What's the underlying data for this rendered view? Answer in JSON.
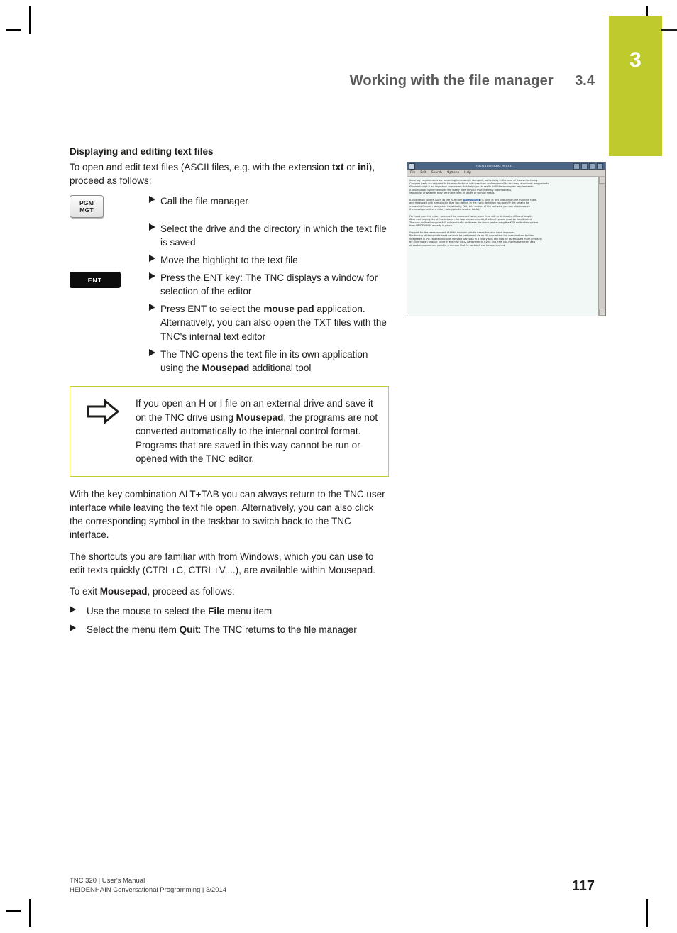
{
  "header": {
    "title": "Working with the file manager",
    "section_number": "3.4",
    "chapter_number": "3"
  },
  "content": {
    "section_title": "Displaying and editing text files",
    "intro_line1_a": "To open and edit text files (ASCII files, e.g. with the extension ",
    "intro_line1_b": "txt",
    "intro_line2_a": "or ",
    "intro_line2_b": "ini",
    "intro_line2_c": "), proceed as follows:",
    "steps": [
      {
        "key": null,
        "text": "Call the file manager"
      },
      {
        "key": "PGM MGT",
        "text": "Select the drive and the directory in which the text file is saved"
      },
      {
        "key": null,
        "text": "Move the highlight to the text file"
      },
      {
        "key": "ENT",
        "text": "Press the ENT key: The TNC displays a window for selection of the editor"
      },
      {
        "key": null,
        "text": "Press ENT to select the mouse pad application. Alternatively, you can also open the TXT files with the TNC's internal text editor"
      },
      {
        "key": null,
        "text": "The TNC opens the text file in its own application using the Mousepad additional tool"
      }
    ],
    "key_pgm_line1": "PGM",
    "key_pgm_line2": "MGT",
    "key_ent": "ENT",
    "note": "If you open an H or I file on an external drive and save it on the TNC drive using Mousepad, the programs are not converted automatically to the internal control format. Programs that are saved in this way cannot be run or opened with the TNC editor.",
    "note_bold": "Mousepad",
    "para_alt_tab": "With the key combination ALT+TAB you can always return to the TNC user interface while leaving the text file open. Alternatively, you can also click the corresponding symbol in the taskbar to switch back to the TNC interface.",
    "para_shortcuts": "The shortcuts you are familiar with from Windows, which you can use to edit texts quickly (CTRL+C, CTRL+V,...), are available within Mousepad.",
    "para_exit_a": "To exit ",
    "para_exit_b": "Mousepad",
    "para_exit_c": ", proceed as follows:",
    "exit_steps": [
      {
        "a": "Use the mouse to select the ",
        "b": "File",
        "c": " menu item"
      },
      {
        "a": "Select the menu item ",
        "b": "Quit",
        "c": ": The TNC returns to the file manager"
      }
    ]
  },
  "screenshot": {
    "window_title": "TncGuideIndex_en.txt",
    "menu_items": [
      "File",
      "Edit",
      "Search",
      "Options",
      "Help"
    ],
    "lines": [
      "Accuracy requirements are becoming increasingly stringent, particularly in the area of 5-axis machining.",
      "Complex parts are required to be manufactured with precision and reproducible accuracy even over long periods.",
      "KinematicsOpt is an important component that helps you to really fulfil these complex requirements:",
      "A touch probe cycle measures the rotary axes on your machine fully automatically,",
      "regardless of whether they are in the form of tables or spindle heads.",
      "",
      "A calibration sphere (such as the KKH from HEIDENHAIN) is fixed at any position on the machine table,",
      "and measured with a resolution that you define. In the cycle definition you specify the area to be",
      "measured for each rotary axis individually. With this version of the software you can also measure",
      "the misalignment of a rotary axis (spindle head or table).",
      "",
      "For head axes the rotary axis must be measured twice, each time with a stylus of a different length.",
      "After exchanging the stylus between the two measurements, the touch probe must be recalibrated.",
      "The new calibration cycle 460 automatically calibrates the touch probe using the KKH calibration sphere",
      "from HEIDENHAIN already in place.",
      "",
      "Support for the measurement of Hirth-coupled spindle heads has also been improved.",
      "Positioning of the spindle head can now be performed via an NC macro that the machine tool builder",
      "integrates in the calibration cycle. Possible backlash in a rotary axis can now be ascertained more precisely.",
      "By entering an angular value in the new Q432 parameter of Cycle 451, the TNC moves the rotary axis",
      "at each measurement point in a manner that its backlash can be ascertained."
    ],
    "highlight_text": "HEIDENHAIN",
    "highlight_line_index": 6
  },
  "footer": {
    "line1": "TNC 320 | User's Manual",
    "line2": "HEIDENHAIN Conversational Programming | 3/2014",
    "page_number": "117"
  },
  "colors": {
    "accent_green": "#bfca2c",
    "note_border": "#c3ce2e",
    "header_gray": "#5a5a5a"
  }
}
